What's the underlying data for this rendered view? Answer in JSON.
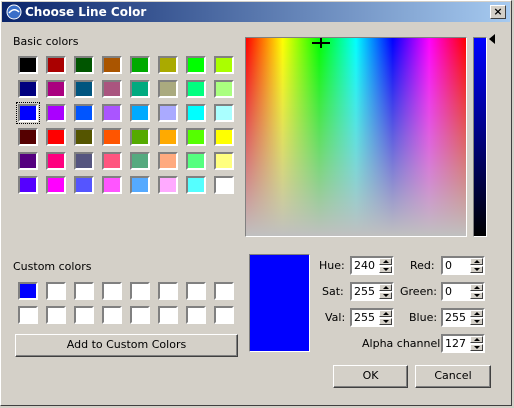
{
  "window": {
    "title": "Choose Line Color",
    "close_glyph": "×",
    "app_icon": "app-icon"
  },
  "basic_colors": {
    "label": "Basic colors",
    "selected_index": 16,
    "colors": [
      "#000000",
      "#aa0000",
      "#005500",
      "#aa5500",
      "#00aa00",
      "#aaaa00",
      "#00ff00",
      "#aaff00",
      "#00007f",
      "#aa007f",
      "#00557f",
      "#aa557f",
      "#00aa7f",
      "#aaaa7f",
      "#00ff7f",
      "#aaff7f",
      "#0000ff",
      "#aa00ff",
      "#0055ff",
      "#aa55ff",
      "#00aaff",
      "#aaaaff",
      "#00ffff",
      "#aaffff",
      "#550000",
      "#ff0000",
      "#555500",
      "#ff5500",
      "#55aa00",
      "#ffaa00",
      "#55ff00",
      "#ffff00",
      "#55007f",
      "#ff007f",
      "#55557f",
      "#ff557f",
      "#55aa7f",
      "#ffaa7f",
      "#55ff7f",
      "#ffff7f",
      "#5500ff",
      "#ff00ff",
      "#5555ff",
      "#ff55ff",
      "#55aaff",
      "#ffaaff",
      "#55ffff",
      "#ffffff"
    ]
  },
  "custom_colors": {
    "label": "Custom colors",
    "colors": [
      "#0000ff",
      "#ffffff",
      "#ffffff",
      "#ffffff",
      "#ffffff",
      "#ffffff",
      "#ffffff",
      "#ffffff",
      "#ffffff",
      "#ffffff",
      "#ffffff",
      "#ffffff",
      "#ffffff",
      "#ffffff",
      "#ffffff",
      "#ffffff"
    ]
  },
  "add_custom_button": "Add to Custom Colors",
  "preview_color": "#0000ff",
  "fields": {
    "hue": {
      "label": "Hue:",
      "value": "240"
    },
    "sat": {
      "label": "Sat:",
      "value": "255"
    },
    "val": {
      "label": "Val:",
      "value": "255"
    },
    "red": {
      "label": "Red:",
      "value": "0"
    },
    "green": {
      "label": "Green:",
      "value": "0"
    },
    "blue": {
      "label": "Blue:",
      "value": "255"
    },
    "alpha": {
      "label": "Alpha channel:",
      "value": "127"
    }
  },
  "buttons": {
    "ok": "OK",
    "cancel": "Cancel"
  }
}
